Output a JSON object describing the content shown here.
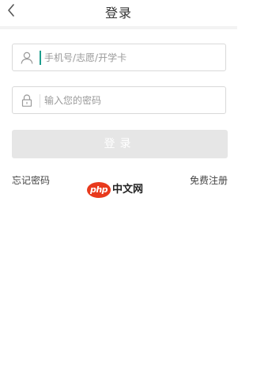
{
  "header": {
    "title": "登录",
    "back_icon": "chevron-left-icon"
  },
  "form": {
    "username": {
      "icon": "user-icon",
      "value": "",
      "placeholder": "手机号/志愿/开学卡"
    },
    "password": {
      "icon": "lock-icon",
      "value": "",
      "placeholder": "输入您的密码"
    },
    "submit_label": "登录"
  },
  "links": {
    "forgot_password": "忘记密码",
    "register": "免费注册"
  },
  "watermark": {
    "logo_text": "php",
    "site_name": "中文网"
  },
  "colors": {
    "accent": "#1f9e8e",
    "button_disabled_bg": "#e6e6e6",
    "border": "#d9d9d9",
    "watermark_red": "#e83a1d"
  }
}
